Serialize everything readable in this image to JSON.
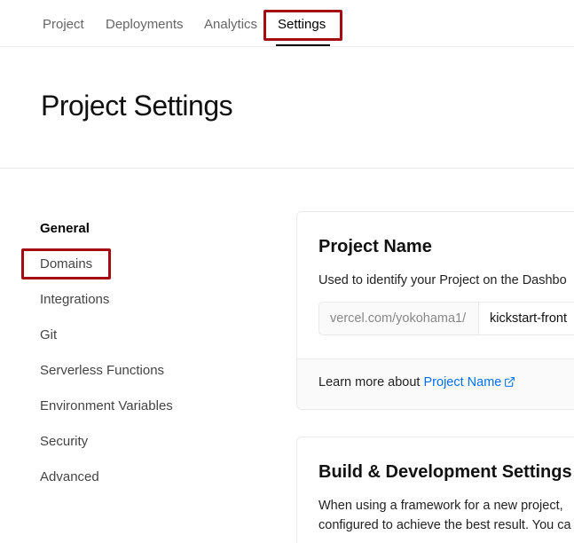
{
  "topnav": {
    "tabs": [
      {
        "label": "Project"
      },
      {
        "label": "Deployments"
      },
      {
        "label": "Analytics"
      },
      {
        "label": "Settings"
      }
    ],
    "active_tab": "Settings"
  },
  "header": {
    "title": "Project Settings"
  },
  "sidebar": {
    "items": [
      {
        "label": "General"
      },
      {
        "label": "Domains"
      },
      {
        "label": "Integrations"
      },
      {
        "label": "Git"
      },
      {
        "label": "Serverless Functions"
      },
      {
        "label": "Environment Variables"
      },
      {
        "label": "Security"
      },
      {
        "label": "Advanced"
      }
    ],
    "active_item": "General"
  },
  "project_name_card": {
    "title": "Project Name",
    "description": "Used to identify your Project on the Dashbo",
    "input_prefix": "vercel.com/yokohama1/",
    "input_value": "kickstart-front",
    "learn_more_text": "Learn more about ",
    "learn_more_link": "Project Name",
    "link_icon": "external-link-icon"
  },
  "build_card": {
    "title": "Build & Development Settings",
    "description_line1": "When using a framework for a new project,",
    "description_line2": "configured to achieve the best result. You ca"
  },
  "colors": {
    "highlight": "#a30d12",
    "link": "#0070f3"
  }
}
